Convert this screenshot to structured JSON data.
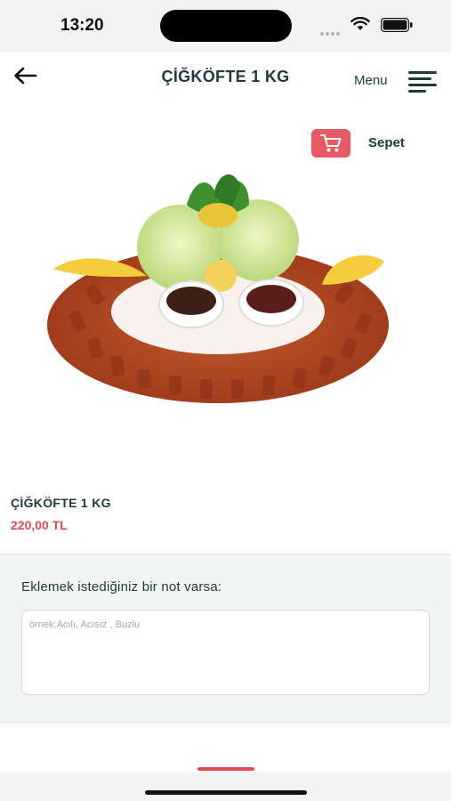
{
  "status_bar": {
    "time": "13:20"
  },
  "header": {
    "title": "ÇİĞKÖFTE 1 KG",
    "menu_label": "Menu"
  },
  "cart": {
    "label": "Sepet"
  },
  "product": {
    "name": "ÇİĞKÖFTE 1 KG",
    "price": "220,00 TL"
  },
  "note": {
    "label": "Eklemek istediğiniz bir not varsa:",
    "placeholder": "örnek:Acılı, Acısız , Buzlu",
    "value": ""
  },
  "colors": {
    "accent": "#e85a62",
    "price": "#e04a55",
    "text": "#1d3b3b"
  }
}
